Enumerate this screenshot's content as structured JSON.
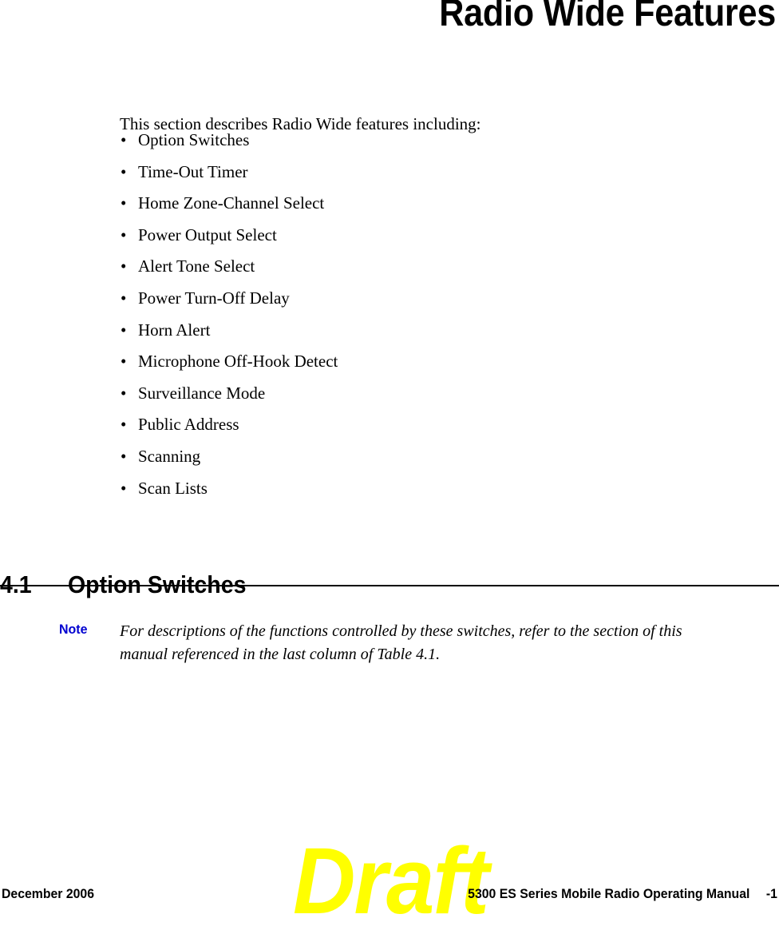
{
  "chapter": {
    "title": "Radio Wide Features"
  },
  "intro": {
    "paragraph": "This section describes Radio Wide features including:"
  },
  "features": {
    "bullet_char": "•",
    "items": [
      {
        "label": "Option Switches"
      },
      {
        "label": "Time-Out Timer"
      },
      {
        "label": "Home Zone-Channel Select"
      },
      {
        "label": "Power Output Select"
      },
      {
        "label": "Alert Tone Select"
      },
      {
        "label": "Power Turn-Off Delay"
      },
      {
        "label": "Horn Alert"
      },
      {
        "label": "Microphone Off-Hook Detect"
      },
      {
        "label": "Surveillance Mode"
      },
      {
        "label": "Public Address"
      },
      {
        "label": "Scanning"
      },
      {
        "label": "Scan Lists"
      }
    ]
  },
  "section": {
    "number": "4.1",
    "name": "Option Switches"
  },
  "note": {
    "label": "Note",
    "label_color": "#0000d0",
    "line1": "For descriptions of the functions controlled by these switches, refer to the section of this",
    "line2": "manual referenced in the last column of Table 4.1."
  },
  "watermark": {
    "text": "Draft",
    "color": "#ffff00"
  },
  "footer": {
    "date": "December 2006",
    "manual_title": "5300 ES Series Mobile Radio Operating Manual",
    "page_number": "-1"
  }
}
